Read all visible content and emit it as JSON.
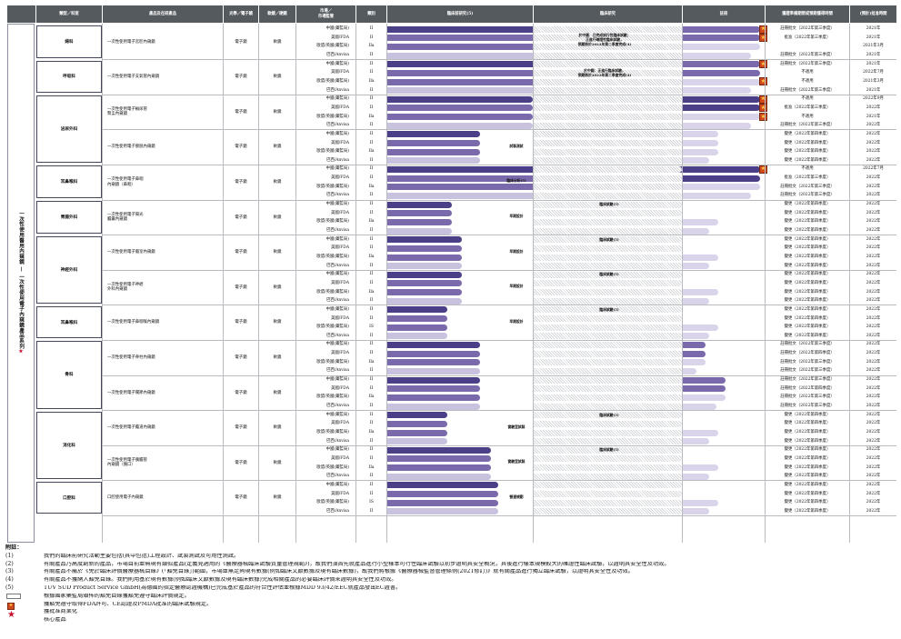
{
  "colors": {
    "header": "#555a5f",
    "registered": "#4b3f87",
    "clinical": "#7b6aab",
    "hatched": "#d2d4d8",
    "core_star": "#c8102e",
    "badge": "#d24a1c"
  },
  "headers": {
    "dept": "類型／科室",
    "product": "產品及在研產品",
    "kind": "光學／電子鏡",
    "mode": "軟鏡／硬鏡",
    "market": "市場／\n市場監管",
    "class": "類別",
    "design": "臨床前研究(5)",
    "clinical": "臨床研究",
    "registration": "註冊",
    "approval_status": "獲證準備期間或預期獲得時間",
    "approval_time": "(預計)批准時間"
  },
  "side_label": "一次性使用醫用內窺鏡 — 一次性使用電子內窺鏡產品系列",
  "side_star": "★",
  "markets": [
    "中國(藥監局)",
    "美國/FDA",
    "歐盟/英國(藥監局)",
    "巴西/Anvisa"
  ],
  "departments": [
    {
      "name": "婦科"
    },
    {
      "name": "呼吸科"
    },
    {
      "name": "泌尿外科"
    },
    {
      "name": "耳鼻喉科"
    },
    {
      "name": "胃腸外科"
    },
    {
      "name": "神經外科"
    },
    {
      "name": "耳鼻喉科"
    },
    {
      "name": "骨科"
    },
    {
      "name": "消化科"
    },
    {
      "name": "口腔科"
    }
  ],
  "products": [
    {
      "name": "一次性使用電子宮腔內窺鏡",
      "kind": "電子鏡",
      "mode": "軟鏡",
      "classes": [
        "II",
        "II",
        "IIa",
        "II"
      ],
      "approvals": [
        [
          "註冊批文（2022年第三季度）",
          "2021年"
        ],
        [
          "批准（2022年第三季度）",
          "2021年"
        ],
        [
          "",
          "2021年3月"
        ],
        [
          "註冊批文（2022年第三季度）",
          "2021年"
        ]
      ],
      "note": "於中國：已完成試行性臨床試驗；\n正進行確證性臨床試驗，\n預期將於2022年第二季度完成(4)"
    },
    {
      "name": "一次性使用電子支氣管內窺鏡",
      "kind": "電子鏡",
      "mode": "軟鏡",
      "classes": [
        "II",
        "II",
        "IIa",
        "II"
      ],
      "approvals": [
        [
          "註冊批文（2022年第三季度）",
          "2021年"
        ],
        [
          "不適用",
          "2022年7月"
        ],
        [
          "不適用",
          "2021年3月"
        ],
        [
          "註冊批文（2022年第三季度）",
          "2021年"
        ]
      ],
      "note": "於中國：正進行臨床試驗，\n預期將於2022年第二季度完成(4)"
    },
    {
      "name": "一次性使用電子輸尿管\n腎盂內窺鏡",
      "kind": "電子鏡",
      "mode": "軟鏡",
      "classes": [
        "II",
        "II",
        "IIa",
        "II"
      ],
      "approvals": [
        [
          "不適用",
          "2022年9月"
        ],
        [
          "批准（2022年第三季度）",
          "2022年"
        ],
        [
          "不適用",
          "2021年"
        ],
        [
          "註冊批文（2022年第三季度）",
          "2022年"
        ]
      ],
      "note": ""
    },
    {
      "name": "一次性使用電子膀胱內窺鏡",
      "kind": "電子鏡",
      "mode": "軟鏡",
      "classes": [
        "II",
        "II",
        "IIa",
        "II"
      ],
      "approvals": [
        [
          "變更（2022年第四季度）",
          "2022年"
        ],
        [
          "變更（2022年第四季度）",
          "2022年"
        ],
        [
          "變更（2022年第四季度）",
          "2022年"
        ],
        [
          "變更（2022年第四季度）",
          "2022年"
        ]
      ],
      "note": "試製測試"
    },
    {
      "name": "一次性使用電子鼻咽\n內窺鏡（鼻咽）",
      "kind": "電子鏡",
      "mode": "軟鏡",
      "classes": [
        "II",
        "II",
        "IIa",
        "II"
      ],
      "approvals": [
        [
          "不適用",
          "2022年7月"
        ],
        [
          "批准（2022年第三季度）",
          "2022年"
        ],
        [
          "註冊批文（2022年第三季度）",
          "2022年"
        ],
        [
          "註冊批文（2022年第三季度）",
          "2022年"
        ]
      ],
      "note": "臨床分析(5)"
    },
    {
      "name": "一次性使用電子陽光\n膽囊內窺鏡",
      "kind": "電子鏡",
      "mode": "軟鏡",
      "classes": [
        "II",
        "II",
        "IIa",
        "II"
      ],
      "approvals": [
        [
          "變更（2022年第四季度）",
          "2022年"
        ],
        [
          "變更（2022年第四季度）",
          "2022年"
        ],
        [
          "變更（2022年第四季度）",
          "2022年"
        ],
        [
          "變更（2022年第四季度）",
          "2022年"
        ]
      ],
      "note": "早期設計"
    },
    {
      "name": "一次性使用電子腦室內窺鏡",
      "kind": "電子鏡",
      "mode": "軟鏡",
      "classes": [
        "II",
        "II",
        "IIa",
        "II"
      ],
      "approvals": [
        [
          "變更（2022年第四季度）",
          "2022年"
        ],
        [
          "變更（2022年第四季度）",
          "2022年"
        ],
        [
          "變更（2022年第四季度）",
          "2022年"
        ],
        [
          "變更（2022年第四季度）",
          "2022年"
        ]
      ],
      "note": "早期設計"
    },
    {
      "name": "一次性使用電子神經\n外科內窺鏡",
      "kind": "電子鏡",
      "mode": "軟鏡",
      "classes": [
        "II",
        "II",
        "IIa",
        "II"
      ],
      "approvals": [
        [
          "變更（2022年第四季度）",
          "2022年"
        ],
        [
          "變更（2022年第四季度）",
          "2022年"
        ],
        [
          "變更（2022年第四季度）",
          "2022年"
        ],
        [
          "變更（2022年第四季度）",
          "2022年"
        ]
      ],
      "note": "早期設計"
    },
    {
      "name": "一次性使用電子鼻咽喉內窺鏡",
      "kind": "電子鏡",
      "mode": "軟鏡",
      "classes": [
        "II",
        "II",
        "IS",
        "II"
      ],
      "approvals": [
        [
          "變更（2022年第四季度）",
          "2022年"
        ],
        [
          "變更（2022年第四季度）",
          "2022年"
        ],
        [
          "變更（2022年第四季度）",
          "2022年"
        ],
        [
          "變更（2022年第四季度）",
          "2022年"
        ]
      ],
      "note": "早期設計"
    },
    {
      "name": "一次性使用電子脊柱內窺鏡",
      "kind": "電子鏡",
      "mode": "軟鏡",
      "classes": [
        "II",
        "II",
        "IIa",
        "II"
      ],
      "approvals": [
        [
          "註冊批文（2022年第三季度）",
          "2022年"
        ],
        [
          "註冊批文（2022年第四季度）",
          "2022年"
        ],
        [
          "註冊批文（2022年第三季度）",
          "2022年"
        ],
        [
          "註冊批文（2022年第三季度）",
          "2022年"
        ]
      ],
      "note": ""
    },
    {
      "name": "一次性使用電子關節內窺鏡",
      "kind": "電子鏡",
      "mode": "軟鏡",
      "classes": [
        "II",
        "II",
        "IIa",
        "II"
      ],
      "approvals": [
        [
          "註冊批文（2022年第三季度）",
          "2022年"
        ],
        [
          "註冊批文（2022年第四季度）",
          "2022年"
        ],
        [
          "註冊批文（2022年第三季度）",
          "2022年"
        ],
        [
          "註冊批文（2022年第三季度）",
          "2022年"
        ]
      ],
      "note": ""
    },
    {
      "name": "一次性使用電子膽道內窺鏡",
      "kind": "電子鏡",
      "mode": "軟鏡",
      "classes": [
        "II",
        "II",
        "IIa",
        "II"
      ],
      "approvals": [
        [
          "變更（2022年第四季度）",
          "2022年"
        ],
        [
          "變更（2022年第四季度）",
          "2022年"
        ],
        [
          "變更（2022年第四季度）",
          "2022年"
        ],
        [
          "變更（2022年第四季度）",
          "2022年"
        ]
      ],
      "note": "實驗室試製"
    },
    {
      "name": "一次性使用電子胰膽管\n內窺鏡（胰口）",
      "kind": "電子鏡",
      "mode": "軟鏡",
      "classes": [
        "II",
        "II",
        "IIa",
        "II"
      ],
      "approvals": [
        [
          "變更（2022年第四季度）",
          "2022年"
        ],
        [
          "變更（2022年第四季度）",
          "2022年"
        ],
        [
          "變更（2022年第四季度）",
          "2022年"
        ],
        [
          "變更（2022年第四季度）",
          "2022年"
        ]
      ],
      "note": "實驗室試製"
    },
    {
      "name": "口腔使用電子內窺鏡",
      "kind": "電子鏡",
      "mode": "軟鏡",
      "classes": [
        "II",
        "II",
        "IS",
        "II"
      ],
      "approvals": [
        [
          "變更（2022年第四季度）",
          "2022年"
        ],
        [
          "變更（2022年第四季度）",
          "2022年"
        ],
        [
          "變更（2022年第四季度）",
          "2022年"
        ],
        [
          "變更（2022年第四季度）",
          "2022年"
        ]
      ],
      "note": "營運規劃"
    }
  ],
  "stage_notes": {
    "clinical_trial": "臨床試驗(5)",
    "clinical_analysis": "臨床分析(5)"
  },
  "footnotes": {
    "title": "附註：",
    "items": [
      {
        "key": "(1)",
        "text": "我們的臨床前研究活動主要包括(其中包括)工程設計、試製測試及可用性測試。"
      },
      {
        "key": "(2)",
        "text": "有關產品乃高度創新的產品，市場目前並無現有類似產品(定義見適用的《醫療器械臨床試驗質量管理規範》)，故我們須首先就產品進行小型樣本可行性臨床試驗以初步證明其安全概況，其後進行樣本規模較大的確證性臨床試驗，以證明其安全性及功效。"
      },
      {
        "key": "(3)",
        "text": "有關產品不屬於《免於臨床評價醫療器械目錄》(「豁免目錄」)範圍，市場並無足夠現有數據(例如臨床文獻數據及現有臨床數據)，故我們將根據《醫療器械監督管理條例(2021修訂)》就有關產品進行獨立臨床試驗，以證明其安全性及功效。"
      },
      {
        "key": "(4)",
        "text": "有關產品不獲納入豁免目錄。我們則用基於現有數據(例如臨床文獻數據及現有臨床數據)完成相關產品的必要臨床評價來證明其安全性及功效。"
      },
      {
        "key": "(5)",
        "text": "TÜV SÜD Product Service GmbH(為德國的指定醫療認證機構)已完成基於產品的符合性評估並根據MDD 93/42/EEC就產品發出EC證書。"
      },
      {
        "key": "",
        "text": "根據國家藥監局頒佈的豁免目錄獲豁免遵守臨床評價規定。"
      },
      {
        "key": "",
        "text": "獲豁免遵守取得FDA許可、CE認證及PMDA批准的臨床試驗規定。"
      },
      {
        "key": "",
        "text": "獲批准商業化"
      },
      {
        "key": "",
        "text": "核心產品"
      }
    ]
  }
}
